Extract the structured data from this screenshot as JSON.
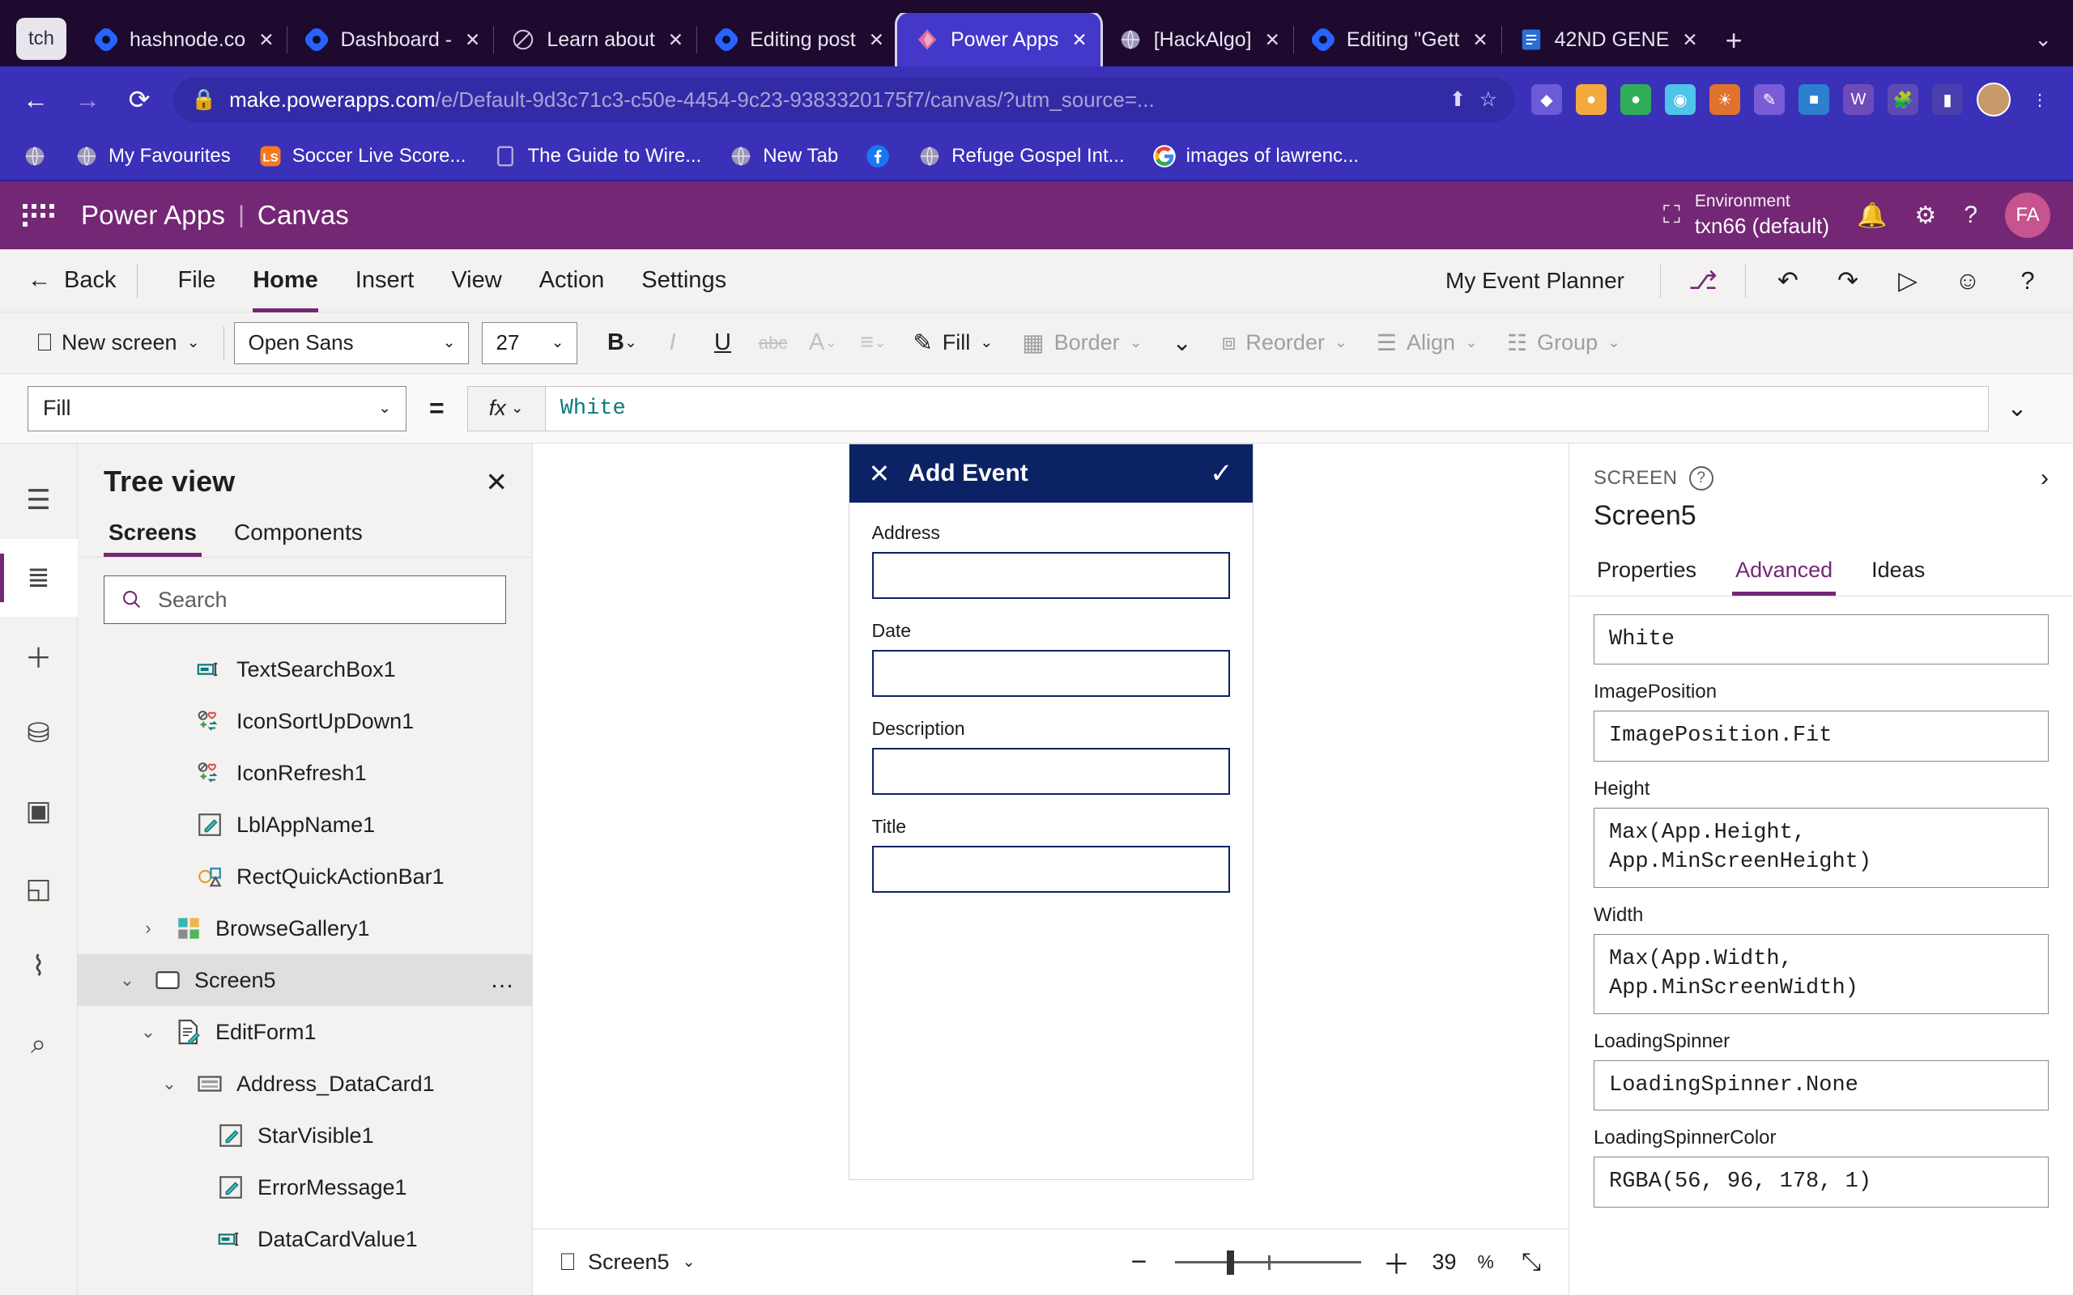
{
  "browser": {
    "profile_chip": "tch",
    "tabs": [
      {
        "title": "hashnode.co",
        "icon": "hashnode-icon",
        "active": false,
        "close": "✕"
      },
      {
        "title": "Dashboard -",
        "icon": "hashnode-icon",
        "active": false,
        "close": "✕"
      },
      {
        "title": "Learn about",
        "icon": "circle-icon",
        "active": false,
        "close": "✕"
      },
      {
        "title": "Editing post",
        "icon": "hashnode-icon",
        "active": false,
        "close": "✕"
      },
      {
        "title": "Power Apps",
        "icon": "powerapps-icon",
        "active": true,
        "close": "✕"
      },
      {
        "title": "[HackAlgo]",
        "icon": "globe-icon",
        "active": false,
        "close": "✕"
      },
      {
        "title": "Editing \"Gett",
        "icon": "hashnode-icon",
        "active": false,
        "close": "✕"
      },
      {
        "title": "42ND GENE",
        "icon": "doc-icon",
        "active": false,
        "close": "✕"
      }
    ],
    "new_tab_label": "+",
    "tab_list_chevron": "⌄",
    "nav": {
      "back": "←",
      "forward": "→",
      "reload": "⟳"
    },
    "address": {
      "lock_icon": "lock-icon",
      "url_bold": "make.powerapps.com",
      "url_rest": "/e/Default-9d3c71c3-c50e-4454-9c23-9383320175f7/canvas/?utm_source=...",
      "share_icon": "⬆",
      "star_icon": "☆"
    },
    "bookmarks": [
      {
        "label": "",
        "icon": "globe-icon"
      },
      {
        "label": "My Favourites",
        "icon": "globe-icon"
      },
      {
        "label": "Soccer Live Score...",
        "icon": "ls-icon"
      },
      {
        "label": "The Guide to Wire...",
        "icon": "square-icon"
      },
      {
        "label": "New Tab",
        "icon": "globe-icon"
      },
      {
        "label": "",
        "icon": "facebook-icon"
      },
      {
        "label": "Refuge Gospel Int...",
        "icon": "globe-icon"
      },
      {
        "label": "images of lawrenc...",
        "icon": "google-icon"
      }
    ]
  },
  "app_header": {
    "waffle_icon": "waffle-icon",
    "product": "Power Apps",
    "separator": "|",
    "mode": "Canvas",
    "environment_label": "Environment",
    "environment_value": "txn66 (default)",
    "env_icon": "environment-icon",
    "bell_icon": "🔔",
    "gear_icon": "⚙",
    "help_icon": "?",
    "user_initials": "FA"
  },
  "ribbon": {
    "back_label": "Back",
    "back_icon": "←",
    "menus": [
      {
        "label": "File",
        "active": false
      },
      {
        "label": "Home",
        "active": true
      },
      {
        "label": "Insert",
        "active": false
      },
      {
        "label": "View",
        "active": false
      },
      {
        "label": "Action",
        "active": false
      },
      {
        "label": "Settings",
        "active": false
      }
    ],
    "app_name": "My Event Planner",
    "icons": [
      {
        "name": "checker-flow-icon",
        "glyph": "⑂"
      },
      {
        "name": "undo-icon",
        "glyph": "↶"
      },
      {
        "name": "redo-icon",
        "glyph": "↷"
      },
      {
        "name": "play-preview-icon",
        "glyph": "▷"
      },
      {
        "name": "share-user-icon",
        "glyph": "⚹"
      },
      {
        "name": "help-icon",
        "glyph": "?"
      }
    ]
  },
  "format_toolbar": {
    "new_screen_label": "New screen",
    "new_screen_icon": "new-screen-icon",
    "font_family": "Open Sans",
    "font_size": "27",
    "bold": "B",
    "italic": "I",
    "underline": "U",
    "strikethrough": "abc",
    "font_color": "A",
    "align": "align-icon",
    "fill_label": "Fill",
    "border_label": "Border",
    "more_icon": "⌄",
    "reorder_label": "Reorder",
    "align_label": "Align",
    "group_label": "Group"
  },
  "formula_bar": {
    "property": "Fill",
    "equals": "=",
    "fx_label": "fx",
    "value": "White",
    "expand_icon": "⌄"
  },
  "left_rail": [
    {
      "name": "hamburger-icon",
      "glyph": "☰",
      "active": false
    },
    {
      "name": "tree-view-icon",
      "glyph": "≣",
      "active": true
    },
    {
      "name": "insert-icon",
      "glyph": "＋",
      "active": false
    },
    {
      "name": "data-icon",
      "glyph": "⛁",
      "active": false
    },
    {
      "name": "media-icon",
      "glyph": "▣",
      "active": false
    },
    {
      "name": "power-automate-icon",
      "glyph": "◱",
      "active": false
    },
    {
      "name": "variables-icon",
      "glyph": "⌇",
      "active": false
    },
    {
      "name": "search-icon",
      "glyph": "⌕",
      "active": false
    }
  ],
  "tree_view": {
    "title": "Tree view",
    "close_icon": "✕",
    "tabs": [
      {
        "label": "Screens",
        "active": true
      },
      {
        "label": "Components",
        "active": false
      }
    ],
    "search_placeholder": "Search",
    "search_icon": "search-icon",
    "items": [
      {
        "label": "TextSearchBox1",
        "icon": "textbox-icon",
        "indent": 3,
        "chevron": "",
        "selected": false,
        "dots": false
      },
      {
        "label": "IconSortUpDown1",
        "icon": "icon-set-icon",
        "indent": 3,
        "chevron": "",
        "selected": false,
        "dots": false
      },
      {
        "label": "IconRefresh1",
        "icon": "icon-set-icon",
        "indent": 3,
        "chevron": "",
        "selected": false,
        "dots": false
      },
      {
        "label": "LblAppName1",
        "icon": "label-icon",
        "indent": 3,
        "chevron": "",
        "selected": false,
        "dots": false
      },
      {
        "label": "RectQuickActionBar1",
        "icon": "shapes-icon",
        "indent": 3,
        "chevron": "",
        "selected": false,
        "dots": false
      },
      {
        "label": "BrowseGallery1",
        "icon": "gallery-icon",
        "indent": 2,
        "chevron": "›",
        "selected": false,
        "dots": false
      },
      {
        "label": "Screen5",
        "icon": "screen-icon",
        "indent": 1,
        "chevron": "⌄",
        "selected": true,
        "dots": true
      },
      {
        "label": "EditForm1",
        "icon": "form-icon",
        "indent": 2,
        "chevron": "⌄",
        "selected": false,
        "dots": false
      },
      {
        "label": "Address_DataCard1",
        "icon": "datacard-icon",
        "indent": 3,
        "chevron": "⌄",
        "selected": false,
        "dots": false
      },
      {
        "label": "StarVisible1",
        "icon": "label-icon",
        "indent": 4,
        "chevron": "",
        "selected": false,
        "dots": false
      },
      {
        "label": "ErrorMessage1",
        "icon": "label-icon",
        "indent": 4,
        "chevron": "",
        "selected": false,
        "dots": false
      },
      {
        "label": "DataCardValue1",
        "icon": "textbox-icon",
        "indent": 4,
        "chevron": "",
        "selected": false,
        "dots": false
      }
    ]
  },
  "canvas": {
    "app_form": {
      "header_title": "Add Event",
      "header_close_icon": "✕",
      "header_check_icon": "✓",
      "fields": [
        {
          "label": "Address",
          "value": ""
        },
        {
          "label": "Date",
          "value": ""
        },
        {
          "label": "Description",
          "value": ""
        },
        {
          "label": "Title",
          "value": ""
        }
      ]
    },
    "footer": {
      "screen_icon": "screen-icon",
      "screen_name": "Screen5",
      "screen_caret": "⌄",
      "zoom_minus": "−",
      "zoom_plus": "＋",
      "zoom_value": "39",
      "zoom_unit": "%",
      "fit_icon": "⤡"
    }
  },
  "properties_panel": {
    "kicker": "SCREEN",
    "help_icon": "?",
    "expand_icon": "›",
    "name": "Screen5",
    "tabs": [
      {
        "label": "Properties",
        "active": false
      },
      {
        "label": "Advanced",
        "active": true
      },
      {
        "label": "Ideas",
        "active": false
      }
    ],
    "fields": [
      {
        "label": "",
        "value": "White"
      },
      {
        "label": "ImagePosition",
        "value": "ImagePosition.Fit"
      },
      {
        "label": "Height",
        "value": "Max(App.Height,\nApp.MinScreenHeight)"
      },
      {
        "label": "Width",
        "value": "Max(App.Width, App.MinScreenWidth)"
      },
      {
        "label": "LoadingSpinner",
        "value": "LoadingSpinner.None"
      },
      {
        "label": "LoadingSpinnerColor",
        "value": "RGBA(56, 96, 178, 1)"
      }
    ]
  },
  "colors": {
    "brand_purple": "#742774",
    "browser_chrome": "#1d0a2e",
    "browser_bar": "#3b30b8",
    "active_tab": "#4338ca",
    "form_navy": "#0b2265",
    "formula_teal": "#0b7a7a"
  }
}
